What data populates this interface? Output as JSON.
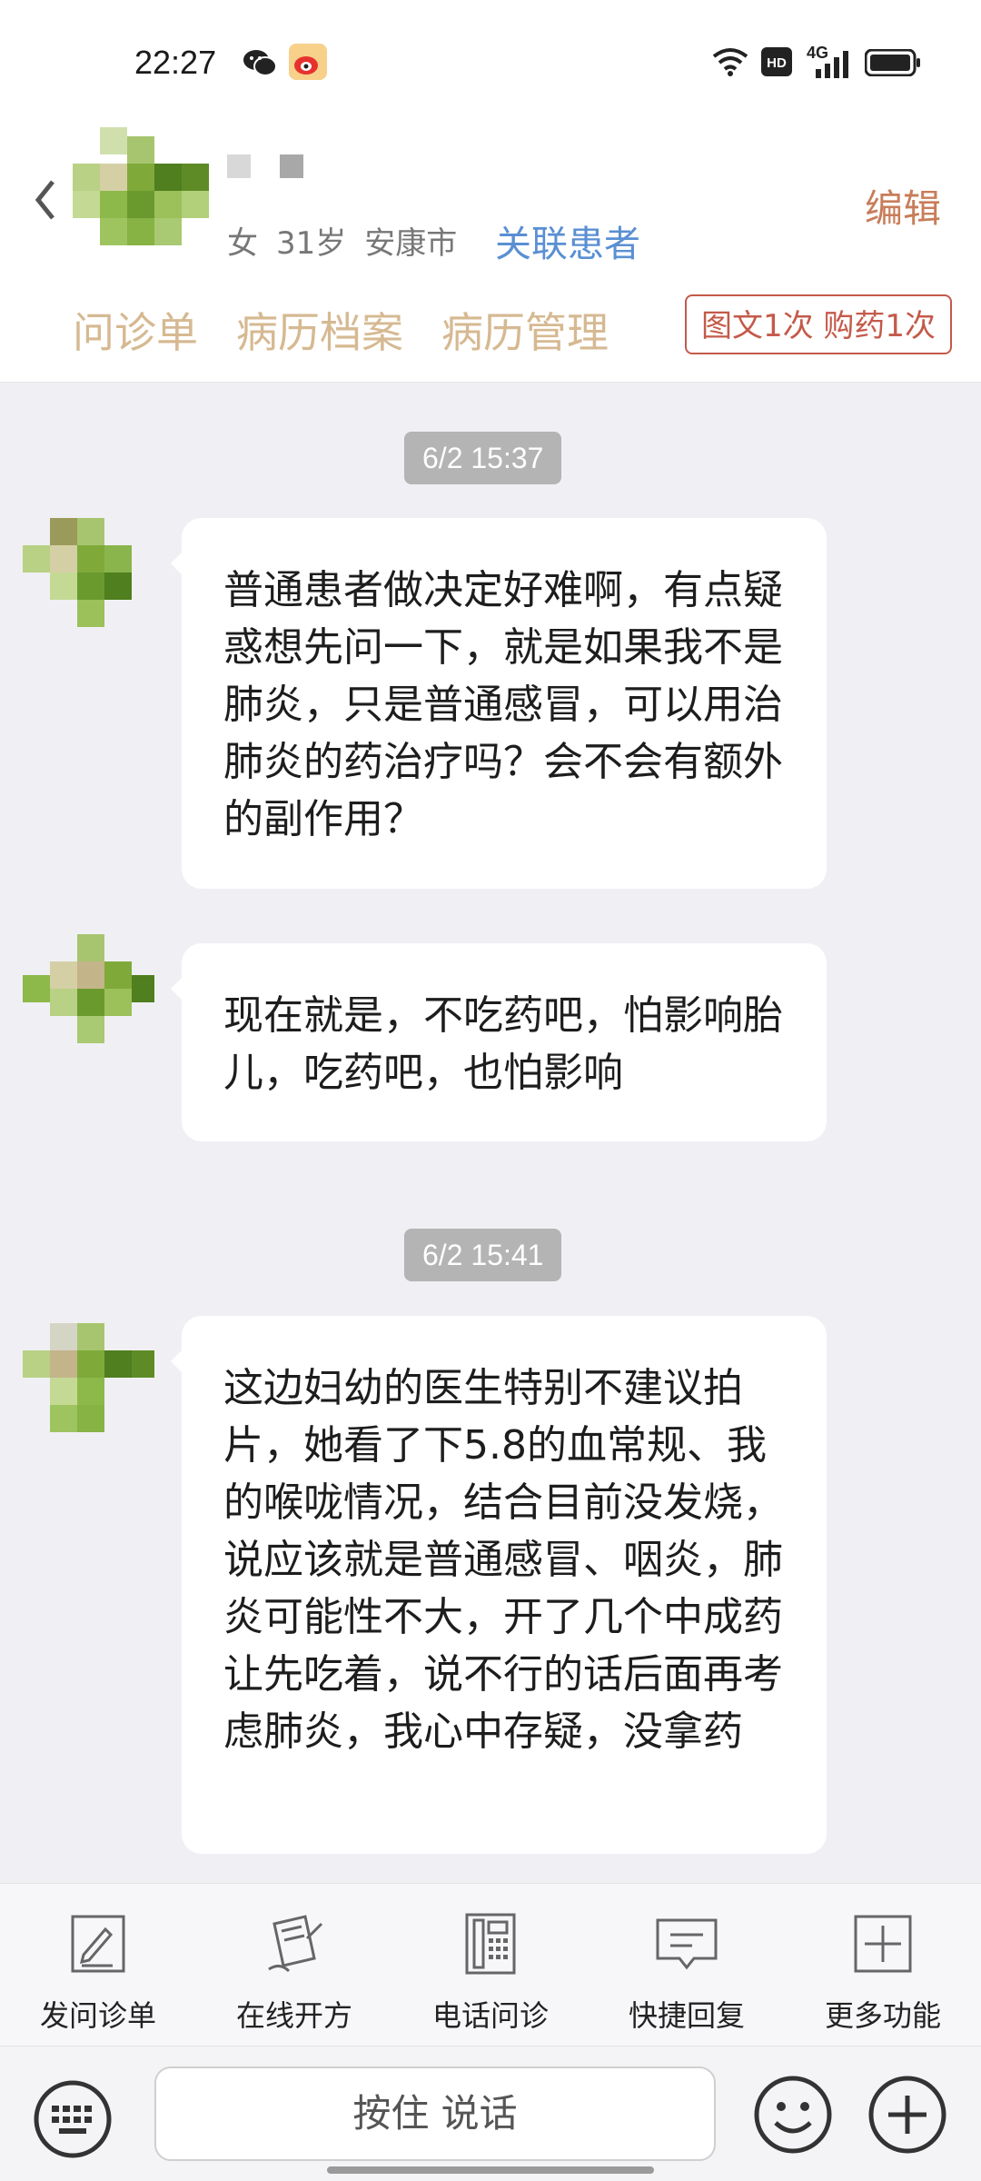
{
  "status_bar": {
    "time": "22:27",
    "network": "4G"
  },
  "patient": {
    "gender": "女",
    "age": "31岁",
    "city": "安康市",
    "link_label": "关联患者",
    "edit_label": "编辑"
  },
  "tabs": [
    "问诊单",
    "病历档案",
    "病历管理"
  ],
  "service_badge": "图文1次 购药1次",
  "messages": [
    {
      "timestamp": "6/2 15:37",
      "text": "普通患者做决定好难啊，有点疑惑想先问一下，就是如果我不是肺炎，只是普通感冒，可以用治肺炎的药治疗吗？会不会有额外的副作用？"
    },
    {
      "timestamp": "",
      "text": "现在就是，不吃药吧，怕影响胎儿，吃药吧，也怕影响"
    },
    {
      "timestamp": "6/2 15:41",
      "text": "这边妇幼的医生特别不建议拍片，她看了下5.8的血常规、我的喉咙情况，结合目前没发烧，说应该就是普通感冒、咽炎，肺炎可能性不大，开了几个中成药让先吃着，说不行的话后面再考虑肺炎，我心中存疑，没拿药"
    }
  ],
  "toolbar": [
    {
      "label": "发问诊单",
      "icon": "form-pen-icon"
    },
    {
      "label": "在线开方",
      "icon": "prescription-icon"
    },
    {
      "label": "电话问诊",
      "icon": "phone-icon"
    },
    {
      "label": "快捷回复",
      "icon": "quick-reply-icon"
    },
    {
      "label": "更多功能",
      "icon": "plus-box-icon"
    }
  ],
  "input": {
    "voice_label": "按住 说话"
  },
  "colors": {
    "accent_blue": "#5a8fd3",
    "tab_gold": "#d6b992",
    "badge_red": "#c45a4a",
    "edit_orange": "#c87d5a"
  }
}
